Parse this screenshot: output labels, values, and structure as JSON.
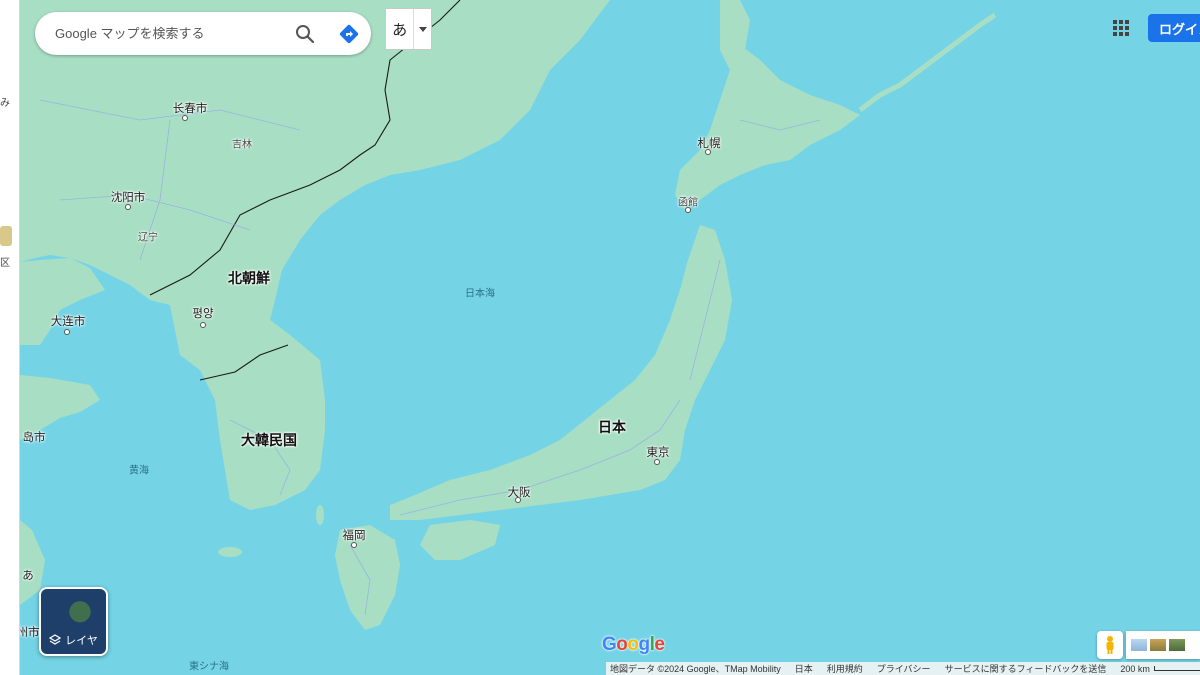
{
  "search": {
    "placeholder": "Google マップを検索する"
  },
  "ime": {
    "char": "あ"
  },
  "account": {
    "login_label": "ログイン"
  },
  "layers": {
    "label": "レイヤ"
  },
  "logo": {
    "text": "Google"
  },
  "map_labels": {
    "countries": {
      "north_korea": "北朝鮮",
      "south_korea": "大韓民国",
      "japan": "日本"
    },
    "provinces": {
      "jilin": "吉林",
      "liaoning": "辽宁"
    },
    "cities": {
      "changchun": "长春市",
      "shenyang": "沈阳市",
      "dalian": "大连市",
      "qingdao_frag": "岛市",
      "pyongyang": "평양",
      "sapporo": "札幌",
      "hakodate": "函館",
      "tokyo": "東京",
      "osaka": "大阪",
      "fukuoka": "福岡"
    },
    "seas": {
      "sea_of_japan": "日本海",
      "yellow_sea": "黄海",
      "east_china_sea": "東シナ海"
    },
    "fragments": {
      "sidebar_mi": "み",
      "sidebar_ku": "区",
      "map_a": "あ",
      "map_shu": "州市"
    }
  },
  "footer": {
    "map_data": "地図データ ©2024 Google、TMap Mobility",
    "country": "日本",
    "terms": "利用規約",
    "privacy": "プライバシー",
    "feedback": "サービスに関するフィードバックを送信",
    "scale": "200 km"
  },
  "colors": {
    "water": "#74d4e6",
    "land": "#a8dfc4",
    "border": "#1a1a1a",
    "login": "#1a73e8"
  }
}
